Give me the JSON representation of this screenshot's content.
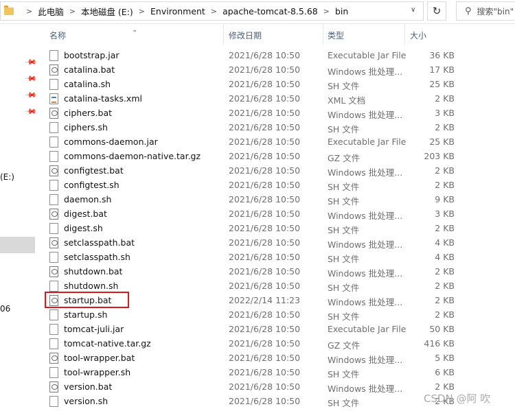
{
  "address": {
    "segments": [
      "此电脑",
      "本地磁盘 (E:)",
      "Environment",
      "apache-tomcat-8.5.68",
      "bin"
    ],
    "separator": ">",
    "dropdown_icon": "chevron-down-icon",
    "refresh_icon": "refresh-icon"
  },
  "search": {
    "placeholder": "搜索\"bin\"",
    "icon": "search-icon"
  },
  "nav": {
    "drive_label": "(E:)",
    "partial_label": "06"
  },
  "columns": {
    "name": "名称",
    "date": "修改日期",
    "type": "类型",
    "size": "大小"
  },
  "files": [
    {
      "name": "bootstrap.jar",
      "date": "2021/6/28 10:50",
      "type": "Executable Jar File",
      "size": "36 KB",
      "icon": "jar-file-icon"
    },
    {
      "name": "catalina.bat",
      "date": "2021/6/28 10:50",
      "type": "Windows 批处理...",
      "size": "17 KB",
      "icon": "batch-file-icon"
    },
    {
      "name": "catalina.sh",
      "date": "2021/6/28 10:50",
      "type": "SH 文件",
      "size": "25 KB",
      "icon": "file-icon"
    },
    {
      "name": "catalina-tasks.xml",
      "date": "2021/6/28 10:50",
      "type": "XML 文档",
      "size": "2 KB",
      "icon": "xml-file-icon"
    },
    {
      "name": "ciphers.bat",
      "date": "2021/6/28 10:50",
      "type": "Windows 批处理...",
      "size": "3 KB",
      "icon": "batch-file-icon"
    },
    {
      "name": "ciphers.sh",
      "date": "2021/6/28 10:50",
      "type": "SH 文件",
      "size": "2 KB",
      "icon": "file-icon"
    },
    {
      "name": "commons-daemon.jar",
      "date": "2021/6/28 10:50",
      "type": "Executable Jar File",
      "size": "25 KB",
      "icon": "jar-file-icon"
    },
    {
      "name": "commons-daemon-native.tar.gz",
      "date": "2021/6/28 10:50",
      "type": "GZ 文件",
      "size": "203 KB",
      "icon": "file-icon"
    },
    {
      "name": "configtest.bat",
      "date": "2021/6/28 10:50",
      "type": "Windows 批处理...",
      "size": "2 KB",
      "icon": "batch-file-icon"
    },
    {
      "name": "configtest.sh",
      "date": "2021/6/28 10:50",
      "type": "SH 文件",
      "size": "2 KB",
      "icon": "file-icon"
    },
    {
      "name": "daemon.sh",
      "date": "2021/6/28 10:50",
      "type": "SH 文件",
      "size": "9 KB",
      "icon": "file-icon"
    },
    {
      "name": "digest.bat",
      "date": "2021/6/28 10:50",
      "type": "Windows 批处理...",
      "size": "3 KB",
      "icon": "batch-file-icon"
    },
    {
      "name": "digest.sh",
      "date": "2021/6/28 10:50",
      "type": "SH 文件",
      "size": "2 KB",
      "icon": "file-icon"
    },
    {
      "name": "setclasspath.bat",
      "date": "2021/6/28 10:50",
      "type": "Windows 批处理...",
      "size": "4 KB",
      "icon": "batch-file-icon"
    },
    {
      "name": "setclasspath.sh",
      "date": "2021/6/28 10:50",
      "type": "SH 文件",
      "size": "4 KB",
      "icon": "file-icon"
    },
    {
      "name": "shutdown.bat",
      "date": "2021/6/28 10:50",
      "type": "Windows 批处理...",
      "size": "2 KB",
      "icon": "batch-file-icon"
    },
    {
      "name": "shutdown.sh",
      "date": "2021/6/28 10:50",
      "type": "SH 文件",
      "size": "2 KB",
      "icon": "file-icon"
    },
    {
      "name": "startup.bat",
      "date": "2022/2/14 11:23",
      "type": "Windows 批处理...",
      "size": "2 KB",
      "icon": "batch-file-icon",
      "highlighted": true
    },
    {
      "name": "startup.sh",
      "date": "2021/6/28 10:50",
      "type": "SH 文件",
      "size": "2 KB",
      "icon": "file-icon"
    },
    {
      "name": "tomcat-juli.jar",
      "date": "2021/6/28 10:50",
      "type": "Executable Jar File",
      "size": "50 KB",
      "icon": "jar-file-icon"
    },
    {
      "name": "tomcat-native.tar.gz",
      "date": "2021/6/28 10:50",
      "type": "GZ 文件",
      "size": "416 KB",
      "icon": "file-icon"
    },
    {
      "name": "tool-wrapper.bat",
      "date": "2021/6/28 10:50",
      "type": "Windows 批处理...",
      "size": "5 KB",
      "icon": "batch-file-icon"
    },
    {
      "name": "tool-wrapper.sh",
      "date": "2021/6/28 10:50",
      "type": "SH 文件",
      "size": "6 KB",
      "icon": "file-icon"
    },
    {
      "name": "version.bat",
      "date": "2021/6/28 10:50",
      "type": "Windows 批处理...",
      "size": "2 KB",
      "icon": "batch-file-icon"
    },
    {
      "name": "version.sh",
      "date": "2021/6/28 10:50",
      "type": "SH 文件",
      "size": "2 KB",
      "icon": "file-icon"
    }
  ],
  "watermark": "CSDN @阿 吹",
  "colors": {
    "highlight": "#e0141b",
    "header_text": "#4c607a",
    "nav_selected": "#d9d9d9"
  }
}
